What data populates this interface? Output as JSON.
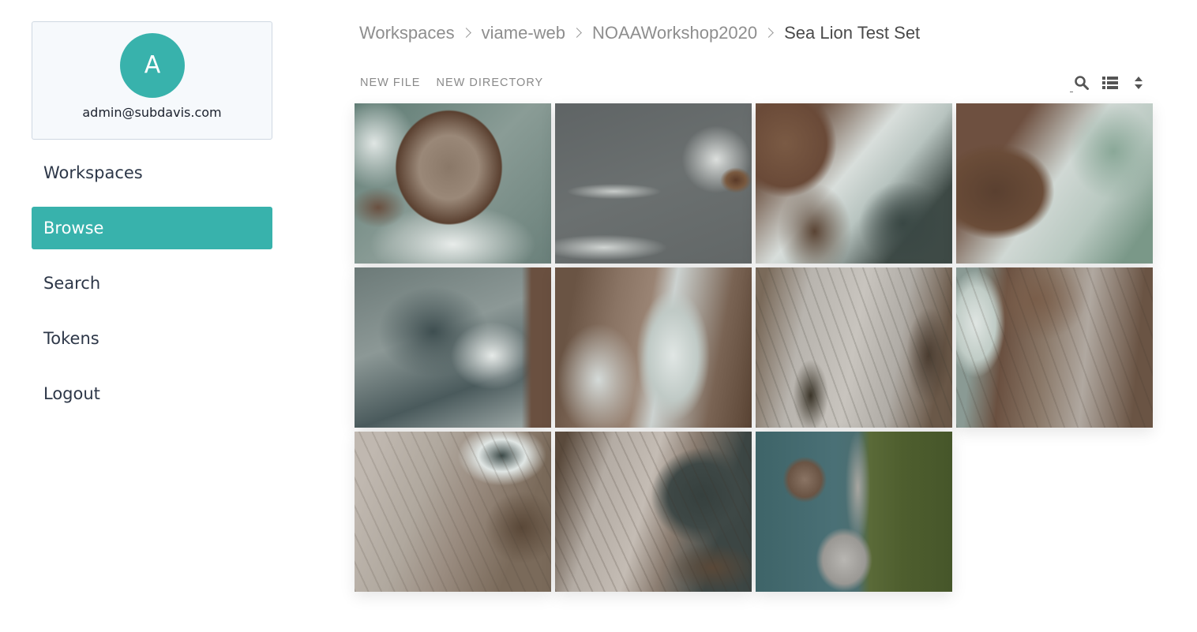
{
  "user": {
    "avatar_initial": "A",
    "email": "admin@subdavis.com",
    "avatar_color": "#38b2ac"
  },
  "nav": {
    "items": [
      {
        "label": "Workspaces",
        "active": false
      },
      {
        "label": "Browse",
        "active": true
      },
      {
        "label": "Search",
        "active": false
      },
      {
        "label": "Tokens",
        "active": false
      },
      {
        "label": "Logout",
        "active": false
      }
    ],
    "active_color": "#38b2ac"
  },
  "breadcrumb": {
    "items": [
      "Workspaces",
      "viame-web",
      "NOAAWorkshop2020",
      "Sea Lion Test Set"
    ],
    "separator_icon": "chevron-right-icon"
  },
  "toolbar": {
    "new_file_label": "NEW FILE",
    "new_directory_label": "NEW DIRECTORY",
    "icons": [
      "search-icon",
      "list-view-icon",
      "sort-icon"
    ]
  },
  "gallery": {
    "images": [
      {
        "description": "aerial rock island surrounded by white surf",
        "theme": "rock-island"
      },
      {
        "description": "dark gray ocean with foam and small rock",
        "theme": "gray-ocean"
      },
      {
        "description": "brown rocky shore with crashing waves",
        "theme": "brown-shore"
      },
      {
        "description": "brown rocks with green-white surf",
        "theme": "brown-surf"
      },
      {
        "description": "turbulent ocean surf with rock edge",
        "theme": "surf-edge"
      },
      {
        "description": "rock fingers with white surf",
        "theme": "rock-fingers"
      },
      {
        "description": "gray striated rock ledge",
        "theme": "gray-rock"
      },
      {
        "description": "sea lion rock with surf on left",
        "theme": "sea-lion-rock"
      },
      {
        "description": "pale rock slope meeting ocean",
        "theme": "pale-slope"
      },
      {
        "description": "striated rock ridge with dark water",
        "theme": "rock-ridge"
      },
      {
        "description": "teal sea, rocks and forested shore",
        "theme": "forest-shore"
      }
    ]
  }
}
